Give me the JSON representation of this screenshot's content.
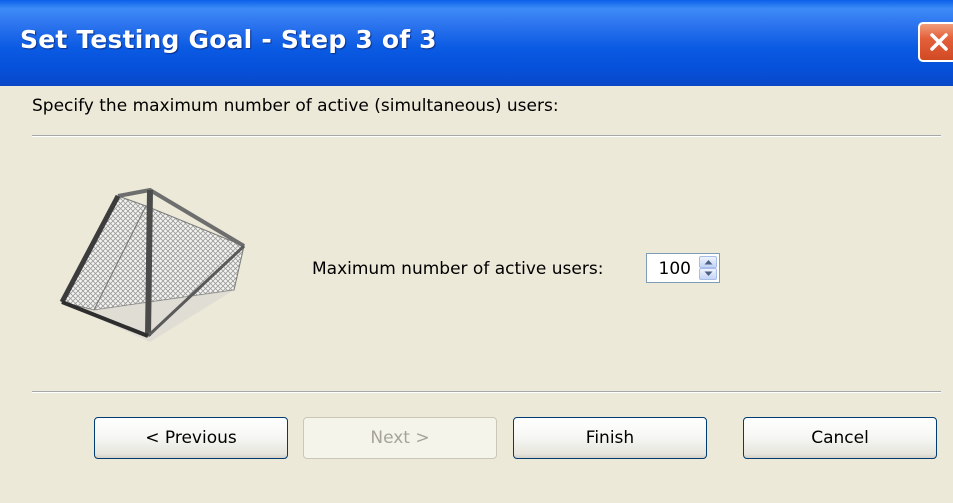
{
  "window": {
    "title": "Set Testing Goal - Step 3 of 3"
  },
  "instruction": "Specify the maximum number of active (simultaneous) users:",
  "field": {
    "label": "Maximum number of active users:",
    "value": "100"
  },
  "buttons": {
    "previous": "< Previous",
    "next": "Next >",
    "finish": "Finish",
    "cancel": "Cancel"
  },
  "icons": {
    "close": "close-icon",
    "goal": "soccer-goal-icon",
    "spin_up": "spin-up-icon",
    "spin_down": "spin-down-icon"
  },
  "colors": {
    "titlebar": "#0A5FE8",
    "close": "#E4603A",
    "dialog_bg": "#ECE9D8"
  }
}
